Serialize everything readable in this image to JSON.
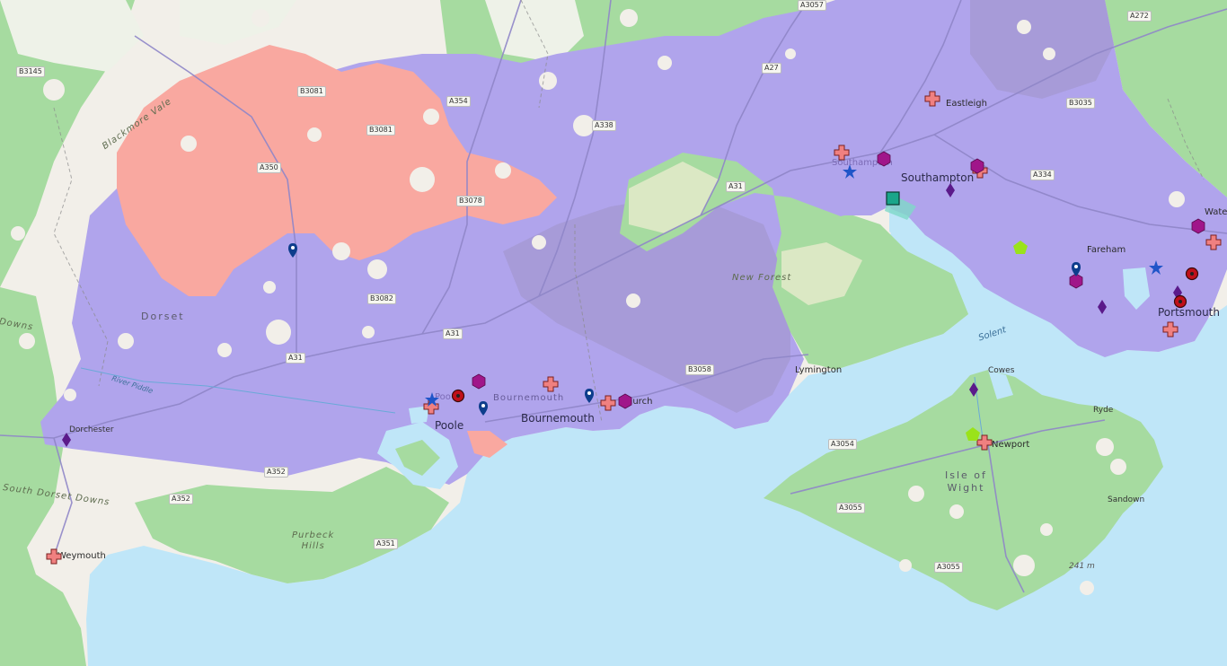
{
  "places": {
    "southampton": "Southampton",
    "southampton_ghost": "Southampton",
    "eastleigh": "Eastleigh",
    "fareham": "Fareham",
    "portsmouth": "Portsmouth",
    "waterlooville": "Wate",
    "lymington": "Lymington",
    "cowes": "Cowes",
    "ryde": "Ryde",
    "newport": "Newport",
    "sandown": "Sandown",
    "poole": "Poole",
    "poole_ghost": "Poo",
    "bournemouth": "Bournemouth",
    "bournemouth_ghost": "Bournemouth",
    "christchurch": "hurch",
    "dorchester": "Dorchester",
    "weymouth": "Weymouth"
  },
  "regions": {
    "dorset": "Dorset",
    "new_forest": "New Forest",
    "isle_of_wight": "Isle of\nWight",
    "purbeck_hills": "Purbeck\nHills",
    "blackmore_vale": "Blackmore Vale",
    "south_dorset_downs": "South Dorset Downs",
    "downs": "Downs"
  },
  "water": {
    "solent": "Solent",
    "river_piddle": "River Piddle"
  },
  "roads": [
    "B3145",
    "B3081",
    "B3081",
    "A350",
    "A354",
    "A338",
    "A27",
    "A3057",
    "B3035",
    "A272",
    "A334",
    "A31",
    "B3078",
    "B3082",
    "A31",
    "A31",
    "B3058",
    "A3054",
    "A3055",
    "A3055",
    "A352",
    "A352",
    "A351"
  ],
  "elevation": "241 m",
  "colors": {
    "sea": "#bfe6f8",
    "land": "#f2efe9",
    "green": "#a6dba0",
    "purple": "#b0a4ec",
    "salmon": "#f9a8a0",
    "cross": "#f08080",
    "hexagon": "#a0168a",
    "diamond": "#5b1a8a",
    "pin": "#0d3d8c",
    "star": "#2055c8",
    "circle": "#c0101a",
    "pentagon": "#9ae31a",
    "square": "#1aa58a"
  },
  "markers": {
    "cross": 15,
    "hexagon": 6,
    "diamond": 6,
    "pin": 6,
    "star": 3,
    "circle": 4,
    "pentagon": 2,
    "square": 1
  }
}
